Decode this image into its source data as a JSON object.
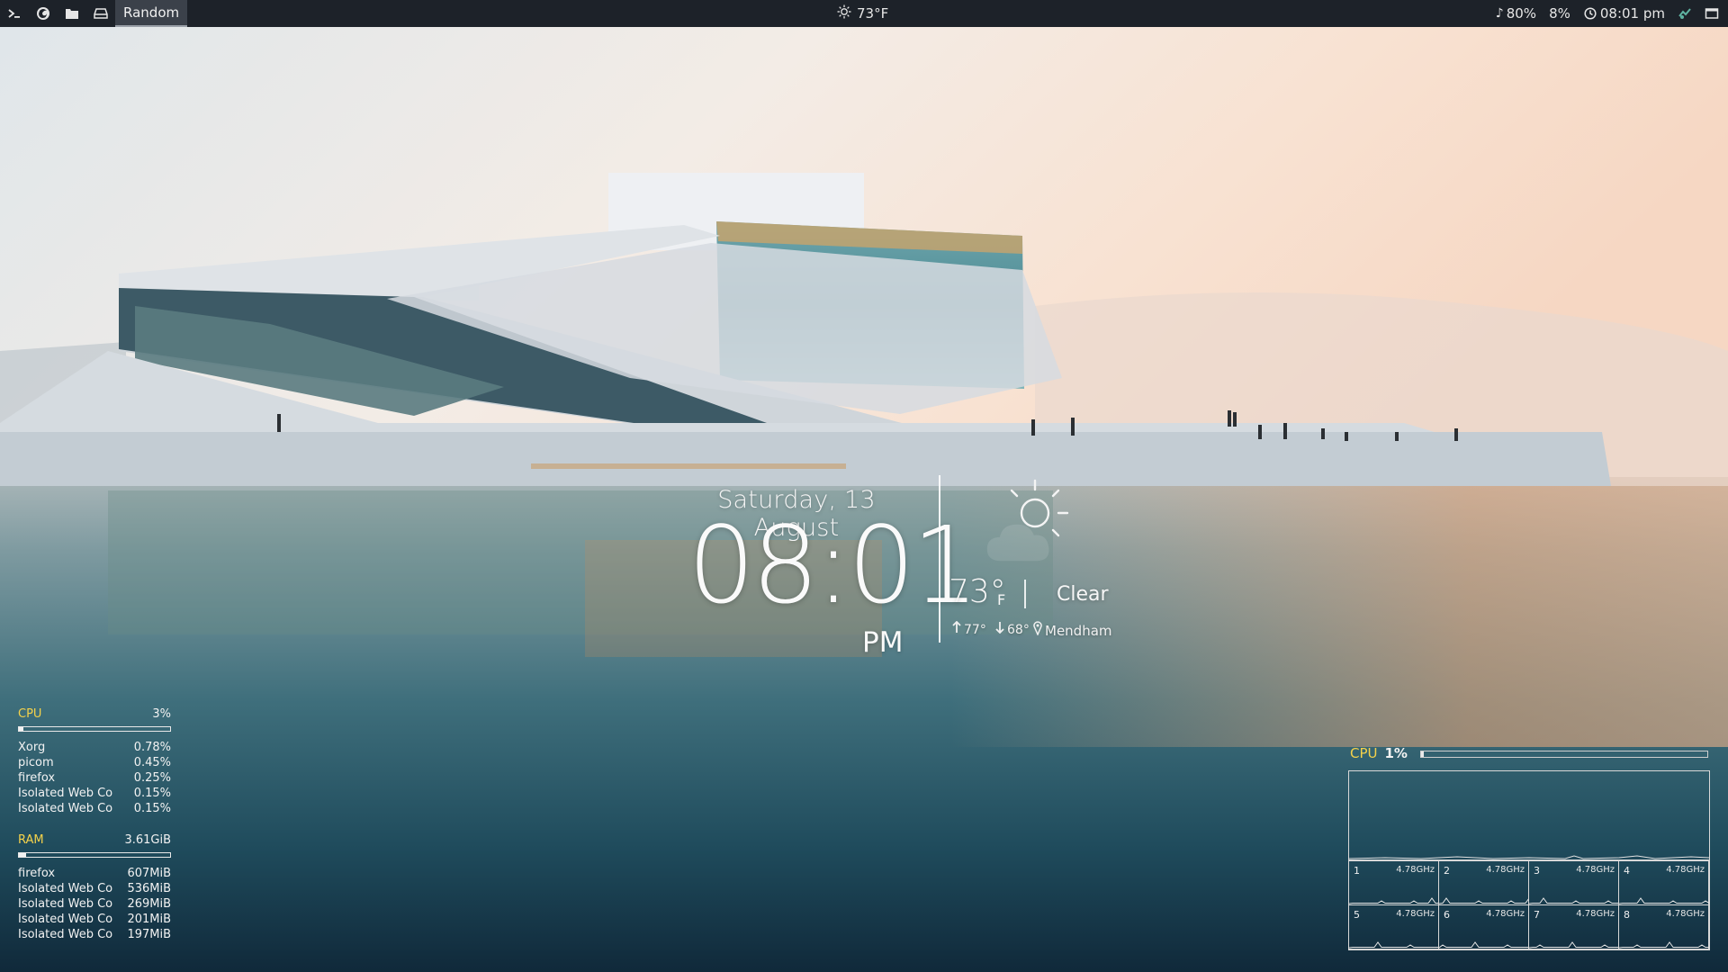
{
  "topbar": {
    "tag_label": "Random",
    "left_icons": [
      "terminal-icon",
      "firefox-icon",
      "folder-icon",
      "drive-icon"
    ],
    "weather": {
      "icon": "sun-icon",
      "text": "73°F"
    },
    "volume": {
      "icon": "music-note-icon",
      "text": "80%"
    },
    "brightness_text": "8%",
    "clock": {
      "icon": "clock-icon",
      "text": "08:01 pm"
    },
    "tray_icons": [
      "network-icon",
      "window-icon"
    ]
  },
  "clock_widget": {
    "date": "Saturday, 13 August",
    "time": "08:01",
    "ampm": "PM"
  },
  "weather_widget": {
    "icon": "partly-cloudy-icon",
    "temp": "73°",
    "unit": "F",
    "condition": "Clear",
    "high": "77°",
    "low": "68°",
    "location": "Mendham"
  },
  "conky_left": {
    "cpu": {
      "label": "CPU",
      "value": "3%",
      "usage": 0.03,
      "processes": [
        {
          "name": "Xorg",
          "value": "0.78%"
        },
        {
          "name": "picom",
          "value": "0.45%"
        },
        {
          "name": "firefox",
          "value": "0.25%"
        },
        {
          "name": "Isolated Web Co",
          "value": "0.15%"
        },
        {
          "name": "Isolated Web Co",
          "value": "0.15%"
        }
      ]
    },
    "ram": {
      "label": "RAM",
      "value": "3.61GiB",
      "usage": 0.05,
      "processes": [
        {
          "name": "firefox",
          "value": "607MiB"
        },
        {
          "name": "Isolated Web Co",
          "value": "536MiB"
        },
        {
          "name": "Isolated Web Co",
          "value": "269MiB"
        },
        {
          "name": "Isolated Web Co",
          "value": "201MiB"
        },
        {
          "name": "Isolated Web Co",
          "value": "197MiB"
        }
      ]
    }
  },
  "conky_right": {
    "label": "CPU",
    "value": "1%",
    "usage": 0.01,
    "cores": [
      {
        "num": "1",
        "freq": "4.78GHz"
      },
      {
        "num": "2",
        "freq": "4.78GHz"
      },
      {
        "num": "3",
        "freq": "4.78GHz"
      },
      {
        "num": "4",
        "freq": "4.78GHz"
      },
      {
        "num": "5",
        "freq": "4.78GHz"
      },
      {
        "num": "6",
        "freq": "4.78GHz"
      },
      {
        "num": "7",
        "freq": "4.78GHz"
      },
      {
        "num": "8",
        "freq": "4.78GHz"
      }
    ]
  },
  "colors": {
    "bar_bg": "#1d2229",
    "accent_yellow": "#f5d24a",
    "text": "#f2f2f2"
  }
}
